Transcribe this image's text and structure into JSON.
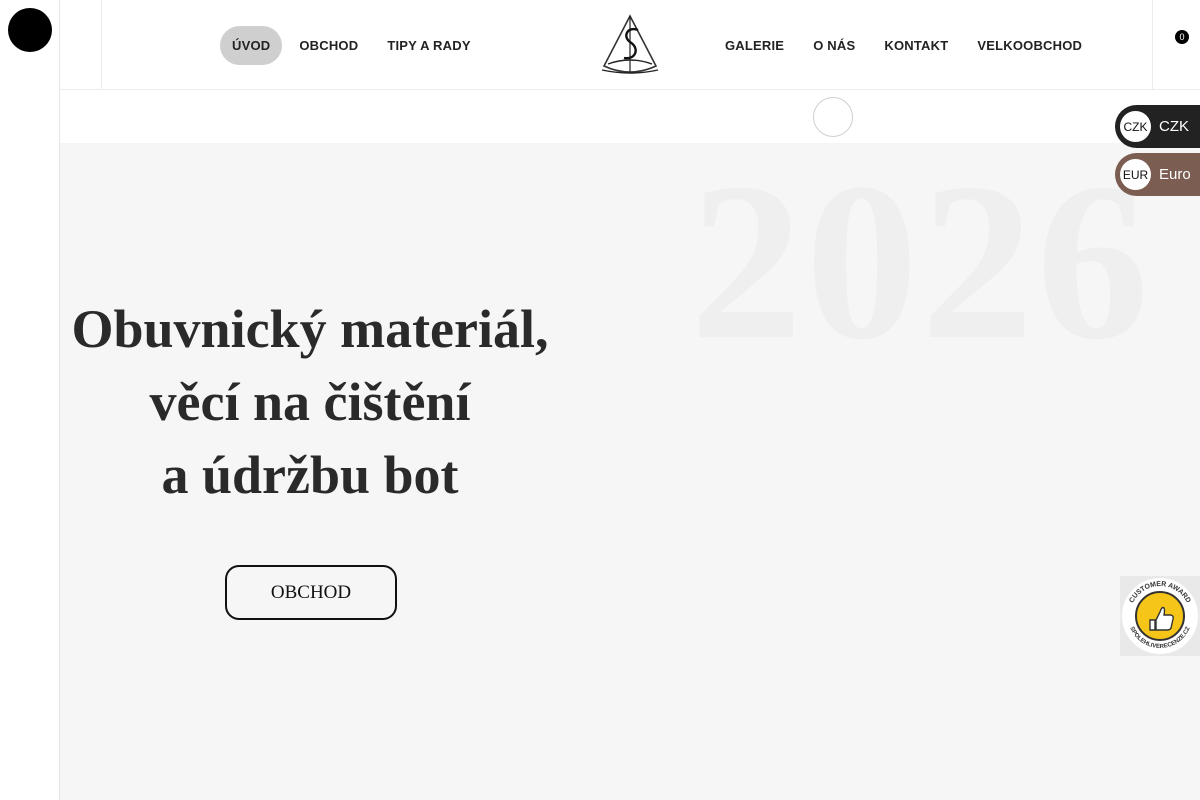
{
  "left_rail": {
    "toggle_icon": "bars-icon",
    "toggle_glyph": ""
  },
  "header": {
    "menu_icon": "hamburger-icon",
    "menu_glyph": "",
    "grid_icon": "grid-icon",
    "grid_glyph": "",
    "search_icon": "search-icon",
    "search_glyph": "",
    "cart_icon": "cart-icon",
    "cart_glyph": "",
    "cart_count": "0",
    "nav_left": [
      {
        "label": "ÚVOD",
        "active": true
      },
      {
        "label": "OBCHOD",
        "active": false
      },
      {
        "label": "TIPY A RADY",
        "active": false
      }
    ],
    "nav_right": [
      {
        "label": "GALERIE"
      },
      {
        "label": "O NÁS"
      },
      {
        "label": "KONTAKT"
      },
      {
        "label": "VELKOOBCHOD"
      }
    ]
  },
  "subbar": {
    "scroll_icon": "chevron-icon",
    "scroll_glyph": ""
  },
  "hero": {
    "year": "2026",
    "headline_line1": "Obuvnický materiál,",
    "headline_line2": "věcí na čištění",
    "headline_line3": "a údržbu bot",
    "cta_label": "OBCHOD"
  },
  "currency_switcher": [
    {
      "code": "CZK",
      "label": "CZK",
      "color": "#222222"
    },
    {
      "code": "EUR",
      "label": "Euro",
      "color": "#7b5d52"
    }
  ],
  "award_badge": {
    "text_top": "CUSTOMER AWARD",
    "text_bottom": "SPOLEHLIVERECENZE.CZ",
    "icon": "thumbs-up-icon"
  },
  "colors": {
    "accent_dark": "#000000",
    "nav_active_bg": "#cfcfcf",
    "hero_bg": "#f6f6f6",
    "badge_gold": "#f5c518"
  }
}
